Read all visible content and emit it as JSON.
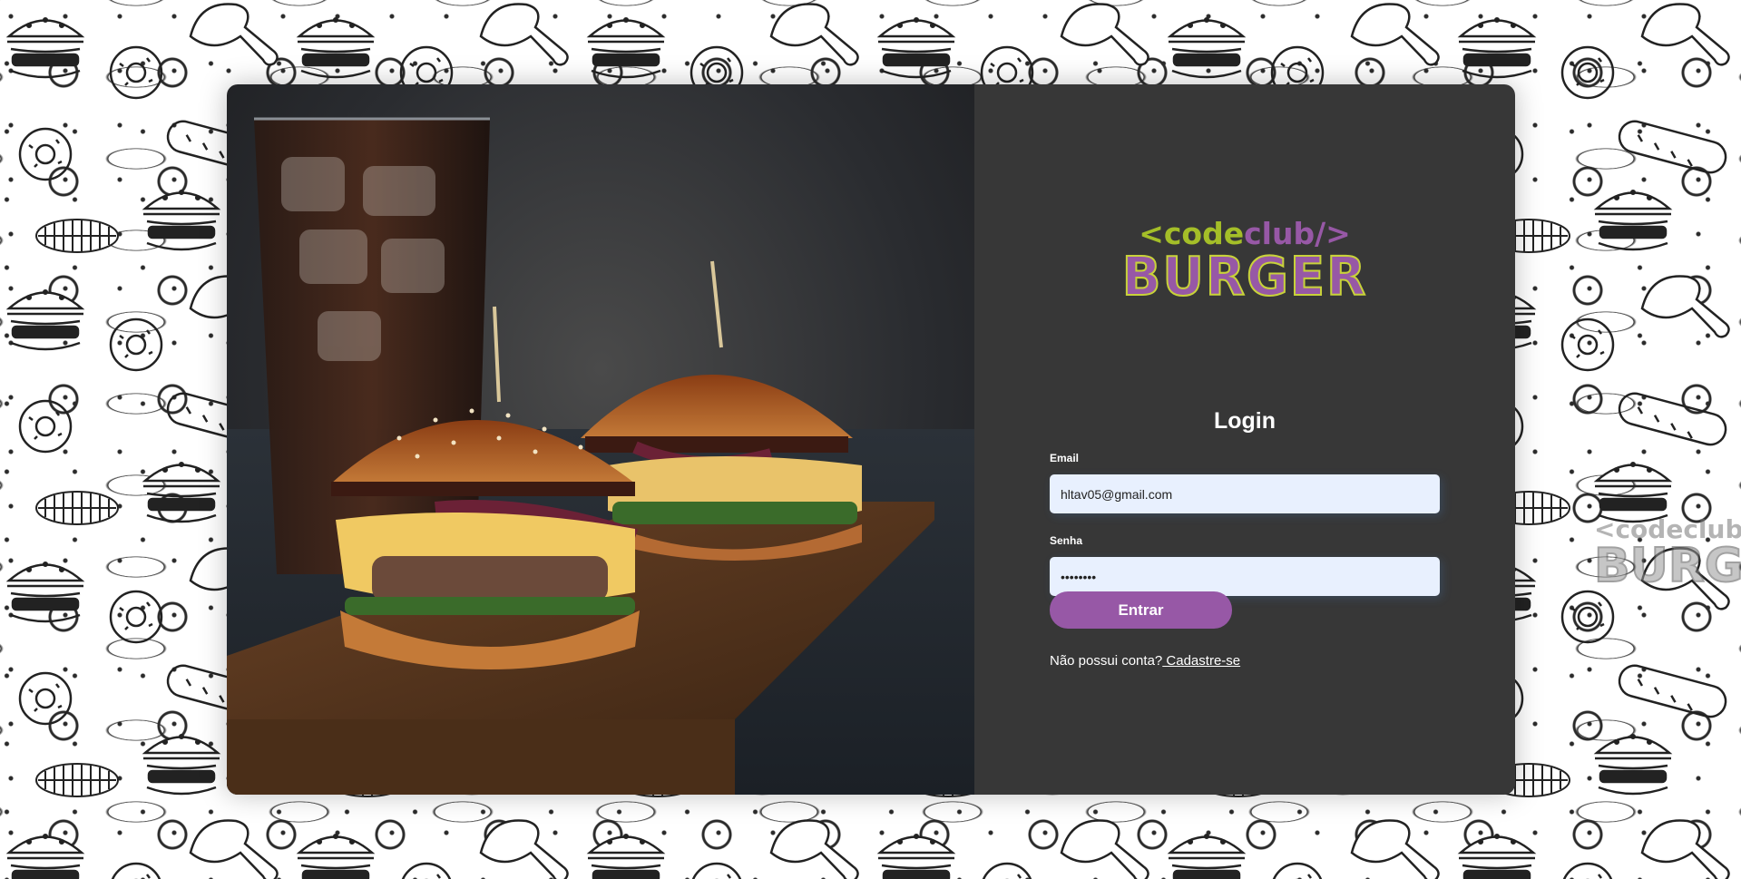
{
  "logo": {
    "open_tag": "<code",
    "club_tag": "club/>",
    "burger": "BURGER"
  },
  "form": {
    "title": "Login",
    "email_label": "Email",
    "email_value": "hltav05@gmail.com",
    "password_label": "Senha",
    "password_value": "••••••••",
    "submit_label": "Entrar",
    "signup_prompt": "Não possui conta?",
    "signup_link": " Cadastre-se"
  },
  "colors": {
    "accent_purple": "#9758a6",
    "accent_green": "#a4be28",
    "panel_bg": "#373737"
  },
  "hero_image": {
    "description_icon": "burger-photo"
  }
}
